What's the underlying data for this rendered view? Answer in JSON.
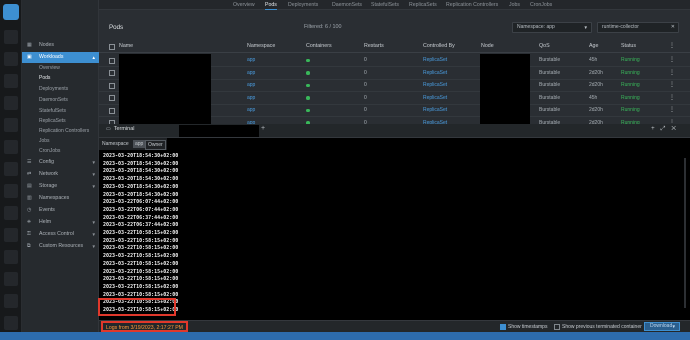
{
  "top_tabs": [
    "Overview",
    "Pods",
    "Deployments",
    "DaemonSets",
    "StatefulSets",
    "ReplicaSets",
    "Replication Controllers",
    "Jobs",
    "CronJobs"
  ],
  "sidebar": {
    "items": [
      {
        "label": "Nodes",
        "icon": "nodes-icon"
      },
      {
        "label": "Workloads",
        "icon": "workloads-icon",
        "active": true
      },
      {
        "label": "Config",
        "icon": "config-icon"
      },
      {
        "label": "Network",
        "icon": "network-icon"
      },
      {
        "label": "Storage",
        "icon": "storage-icon"
      },
      {
        "label": "Namespaces",
        "icon": "namespaces-icon"
      },
      {
        "label": "Events",
        "icon": "events-icon"
      },
      {
        "label": "Helm",
        "icon": "helm-icon"
      },
      {
        "label": "Access Control",
        "icon": "access-control-icon"
      },
      {
        "label": "Custom Resources",
        "icon": "custom-resources-icon"
      }
    ],
    "workload_subitems": [
      "Overview",
      "Pods",
      "Deployments",
      "DaemonSets",
      "StatefulSets",
      "ReplicaSets",
      "Replication Controllers",
      "Jobs",
      "CronJobs"
    ]
  },
  "pods": {
    "title": "Pods",
    "filter_text": "Filtered: 6 / 100",
    "namespace_select": "Namespace: app",
    "search_value": "runtime-collector",
    "columns": [
      "Name",
      "Namespace",
      "Containers",
      "Restarts",
      "Controlled By",
      "Node",
      "QoS",
      "Age",
      "Status"
    ],
    "rows": [
      {
        "namespace": "app",
        "restarts": "0",
        "controlled_by": "ReplicaSet",
        "qos": "Burstable",
        "age": "45h",
        "status": "Running"
      },
      {
        "namespace": "app",
        "restarts": "0",
        "controlled_by": "ReplicaSet",
        "qos": "Burstable",
        "age": "2d20h",
        "status": "Running"
      },
      {
        "namespace": "app",
        "restarts": "0",
        "controlled_by": "ReplicaSet",
        "qos": "Burstable",
        "age": "2d20h",
        "status": "Running"
      },
      {
        "namespace": "app",
        "restarts": "0",
        "controlled_by": "ReplicaSet",
        "qos": "Burstable",
        "age": "45h",
        "status": "Running"
      },
      {
        "namespace": "app",
        "restarts": "0",
        "controlled_by": "ReplicaSet",
        "qos": "Burstable",
        "age": "2d20h",
        "status": "Running"
      },
      {
        "namespace": "app",
        "restarts": "0",
        "controlled_by": "ReplicaSet",
        "qos": "Burstable",
        "age": "2d20h",
        "status": "Running"
      }
    ]
  },
  "terminal": {
    "tab_label": "Terminal",
    "filter_labels": {
      "namespace": "Namespace",
      "app": "app",
      "owner": "Owner"
    },
    "log_lines": [
      "2023-03-20T18:54:30+02:00",
      "2023-03-20T18:54:30+02:00",
      "2023-03-20T18:54:30+02:00",
      "2023-03-20T18:54:30+02:00",
      "2023-03-20T18:54:30+02:00",
      "2023-03-20T18:54:30+02:00",
      "2023-03-22T06:07:44+02:00",
      "2023-03-22T06:07:44+02:00",
      "2023-03-22T06:37:44+02:00",
      "2023-03-22T06:37:44+02:00",
      "2023-03-22T10:58:15+02:00",
      "2023-03-22T10:58:15+02:00",
      "2023-03-22T10:58:15+02:00",
      "2023-03-22T10:58:15+02:00",
      "2023-03-22T10:58:15+02:00",
      "2023-03-22T10:58:15+02:00",
      "2023-03-22T10:58:15+02:00",
      "2023-03-22T10:58:15+02:00",
      "2023-03-22T10:58:15+02:00",
      "2023-03-22T10:58:15+02:00",
      "2023-03-22T10:58:15+02:00"
    ],
    "logs_from": "Logs from 3/19/2023, 2:17:27 PM",
    "show_timestamps": "Show timestamps",
    "show_previous": "Show previous terminated container",
    "download": "Download"
  },
  "colors": {
    "accent": "#3d8fd1",
    "running": "#39b85a",
    "highlight": "#e1382b",
    "logs_from_text": "#ff9a3a"
  }
}
